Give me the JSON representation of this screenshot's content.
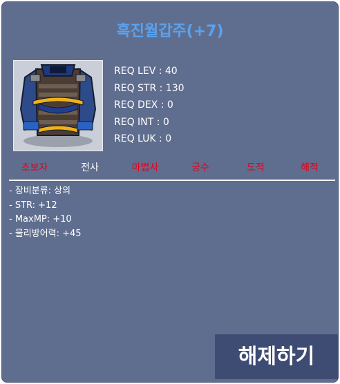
{
  "item": {
    "name": "흑진월갑주(+7)",
    "icon": "armor-icon",
    "requirements": [
      "REQ LEV : 40",
      "REQ STR : 130",
      "REQ DEX : 0",
      "REQ INT : 0",
      "REQ LUK : 0"
    ]
  },
  "jobs": [
    {
      "label": "초보자",
      "color": "#e0001b"
    },
    {
      "label": "전사",
      "color": "#ffffff"
    },
    {
      "label": "마법사",
      "color": "#e0001b"
    },
    {
      "label": "궁수",
      "color": "#e0001b"
    },
    {
      "label": "도적",
      "color": "#e0001b"
    },
    {
      "label": "해적",
      "color": "#e0001b"
    }
  ],
  "stats": [
    "- 장비분류: 상의",
    "- STR: +12",
    "- MaxMP: +10",
    "- 물리방어력: +45"
  ],
  "actions": {
    "unequip_label": "해제하기"
  },
  "colors": {
    "panel": "#5f6e8f",
    "title": "#5aa2ee",
    "restricted_job": "#e0001b",
    "allowed_job": "#ffffff",
    "button": "#3e4c74"
  }
}
